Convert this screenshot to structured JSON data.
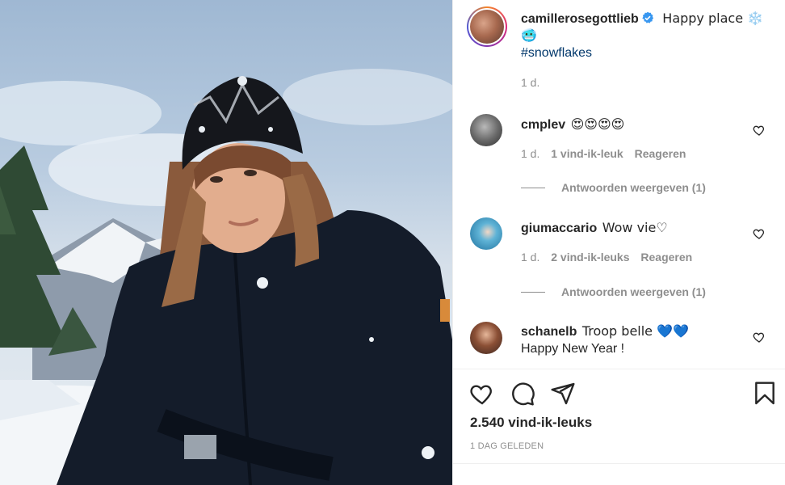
{
  "post": {
    "author": "camillerosegottlieb",
    "caption": "Happy place ❄️",
    "caption_emoji_2": "🥶",
    "hashtag": "#snowflakes",
    "age": "1 d."
  },
  "comments": [
    {
      "user": "cmplev",
      "text": "😍😍😍😍",
      "age": "1 d.",
      "likes": "1 vind-ik-leuk",
      "reply": "Reageren",
      "view_replies": "Antwoorden weergeven (1)",
      "like_icon": "heart-outline-icon"
    },
    {
      "user": "giumaccario",
      "text": "Wow vie♡",
      "age": "1 d.",
      "likes": "2 vind-ik-leuks",
      "reply": "Reageren",
      "view_replies": "Antwoorden weergeven (1)",
      "like_icon": "heart-outline-icon"
    },
    {
      "user": "schanelb",
      "text": "Troop belle 💙💙",
      "text_line2": "Happy New Year !",
      "like_icon": "heart-outline-icon"
    }
  ],
  "actions": {
    "icons": [
      "heart-outline-icon",
      "comment-icon",
      "share-icon",
      "bookmark-icon"
    ],
    "likes_count": "2.540 vind-ik-leuks",
    "posted": "1 DAG GELEDEN"
  },
  "colors": {
    "text": "#262626",
    "secondary": "#8e8e8e",
    "hashtag": "#00376b",
    "verified": "#3897f0",
    "border": "#efefef"
  }
}
